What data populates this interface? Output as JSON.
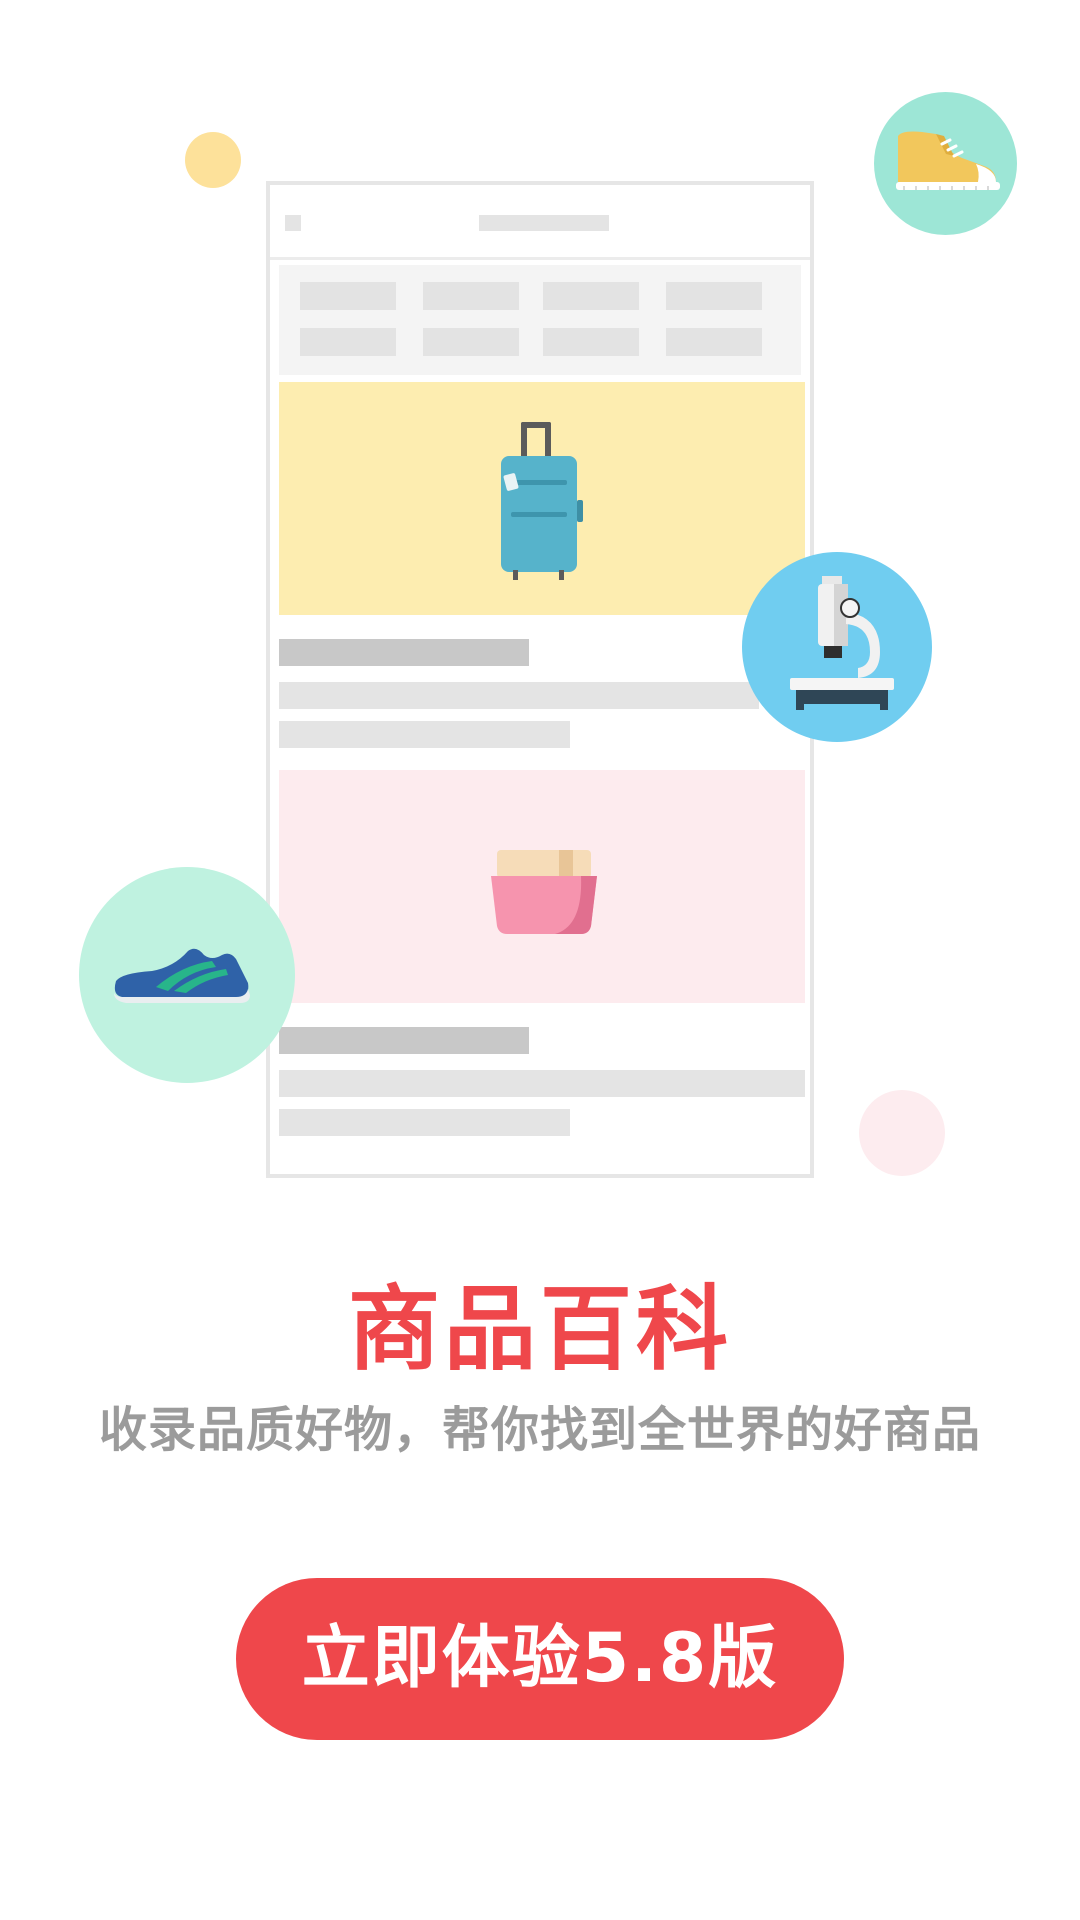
{
  "promo": {
    "title": "商品百科",
    "subtitle": "收录品质好物，帮你找到全世界的好商品",
    "cta_label": "立即体验5.8版"
  },
  "illustration": {
    "icons": [
      "suitcase-icon",
      "cosmetic-jar-icon",
      "sneaker-icon",
      "microscope-icon",
      "running-shoe-icon"
    ]
  },
  "colors": {
    "accent": "#ef474b",
    "subtitle_gray": "#9b9b9b",
    "banner_yellow": "#fdedb0",
    "banner_pink": "#fdebee",
    "circle_mint": "#9de6d6",
    "circle_blue": "#70cdf0",
    "circle_light_mint": "#bff2e0"
  }
}
